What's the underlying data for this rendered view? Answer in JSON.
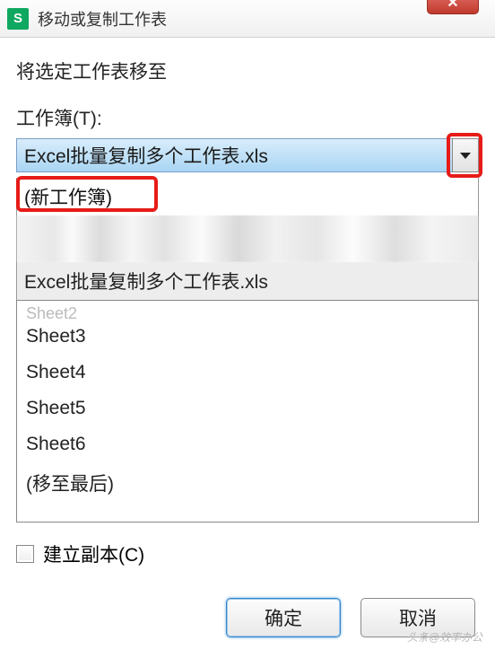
{
  "titlebar": {
    "app_icon_letter": "S",
    "title": "移动或复制工作表",
    "close_label": "✕"
  },
  "labels": {
    "move_to": "将选定工作表移至",
    "workbook": "工作簿(T):",
    "create_copy": "建立副本(C)"
  },
  "dropdown": {
    "selected": "Excel批量复制多个工作表.xls",
    "options": {
      "new_workbook": "(新工作簿)",
      "current_file": "Excel批量复制多个工作表.xls"
    }
  },
  "sheets": {
    "items": [
      "Sheet3",
      "Sheet4",
      "Sheet5",
      "Sheet6"
    ],
    "partial_top": "Sheet2",
    "move_last": "(移至最后)"
  },
  "buttons": {
    "ok": "确定",
    "cancel": "取消"
  },
  "watermark": "头条@效率办公"
}
